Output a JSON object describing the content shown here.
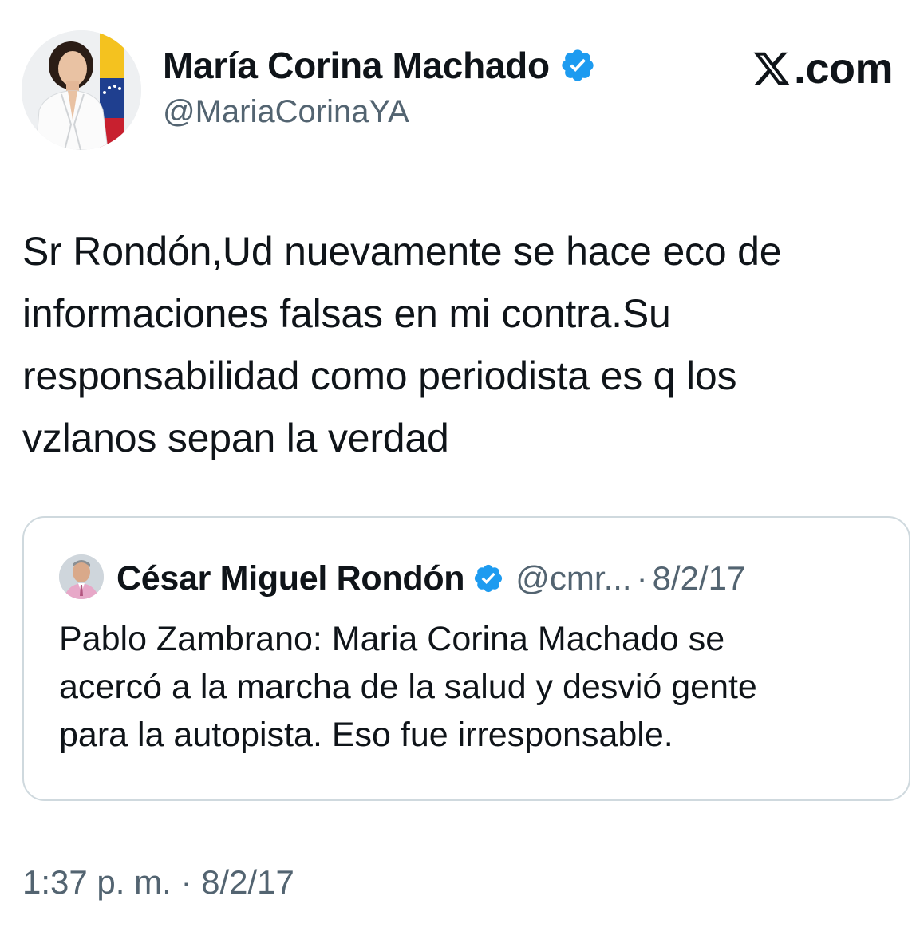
{
  "brand": {
    "label": ".com",
    "icon": "x-logo-icon"
  },
  "author": {
    "display_name": "María Corina Machado",
    "handle": "@MariaCorinaYA",
    "verified_icon": "verified-badge-icon",
    "avatar_icon": "avatar-photo"
  },
  "tweet": {
    "text": "Sr Rondón,Ud nuevamente se hace eco de\ninformaciones falsas en mi contra.Su\nresponsabilidad como periodista es q los\nvzlanos sepan la verdad"
  },
  "quoted_tweet": {
    "display_name": "César Miguel Rondón",
    "handle": "@cmr...",
    "separator": "·",
    "date": "8/2/17",
    "text": "Pablo Zambrano: Maria Corina Machado se\nacercó a la marcha de la salud y desvió gente\npara la autopista. Eso fue irresponsable.",
    "verified_icon": "verified-badge-icon"
  },
  "footer": {
    "time": "1:37 p. m.",
    "separator": "·",
    "date": "8/2/17"
  },
  "colors": {
    "text_primary": "#0f1419",
    "text_secondary": "#536471",
    "verified_blue": "#1d9bf0",
    "border": "#cfd9de"
  }
}
